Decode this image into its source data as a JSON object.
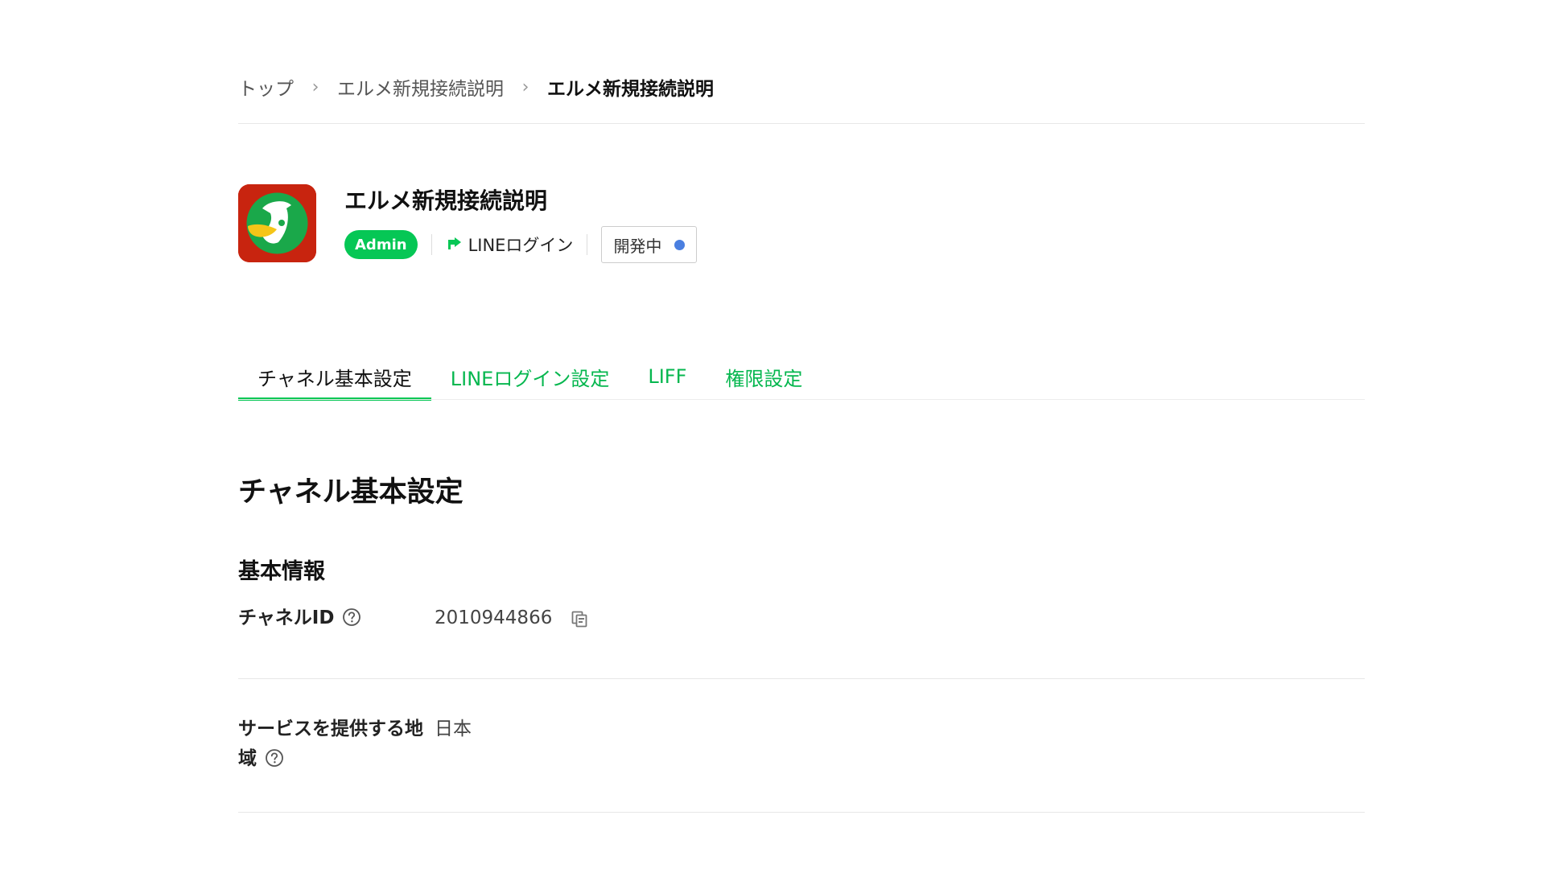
{
  "breadcrumb": {
    "items": [
      "トップ",
      "エルメ新規接続説明",
      "エルメ新規接続説明"
    ],
    "separator": "›"
  },
  "channel": {
    "name": "エルメ新規接続説明",
    "role_badge": "Admin",
    "login_type": "LINEログイン",
    "status": "開発中",
    "icon": "pelican-app-icon",
    "colors": {
      "icon_background": "#c8240f",
      "accent_green": "#06c755",
      "status_dot": "#4a7fe0"
    }
  },
  "tabs": [
    {
      "label": "チャネル基本設定",
      "active": true
    },
    {
      "label": "LINEログイン設定",
      "active": false
    },
    {
      "label": "LIFF",
      "active": false
    },
    {
      "label": "権限設定",
      "active": false
    }
  ],
  "main": {
    "section_title": "チャネル基本設定",
    "subsection_title": "基本情報",
    "fields": [
      {
        "label": "チャネルID",
        "value": "2010944866",
        "has_help": true,
        "has_copy": true
      },
      {
        "label": "サービスを提供する地域",
        "value": "日本",
        "has_help": true,
        "has_copy": false
      }
    ]
  }
}
